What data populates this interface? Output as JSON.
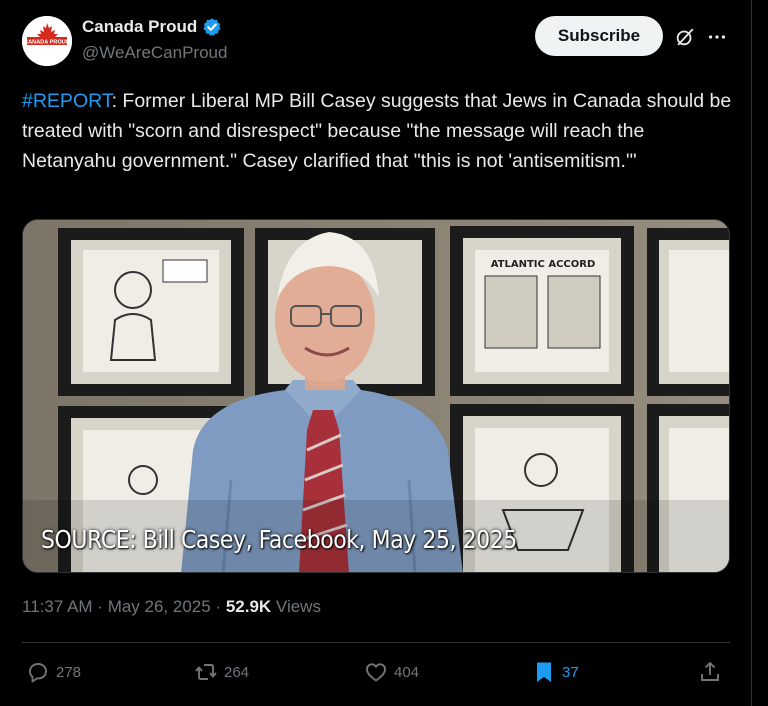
{
  "author": {
    "display_name": "Canada Proud",
    "handle": "@WeAreCanProud",
    "avatar_text": "CANADA PROUD",
    "verified": true
  },
  "subscribe_label": "Subscribe",
  "tweet": {
    "hashtag": "#REPORT",
    "body": ": Former Liberal MP Bill Casey suggests that Jews in Canada should be treated with \"scorn and disrespect\" because \"the message will reach the Netanyahu government.\" Casey clarified that \"this is not 'antisemitism.'\""
  },
  "media": {
    "caption": "SOURCE: Bill Casey, Facebook, May 25, 2025",
    "frame_text": "ATLANTIC ACCORD"
  },
  "meta": {
    "time": "11:37 AM",
    "separator1": " · ",
    "date": "May 26, 2025",
    "separator2": " · ",
    "views_count": "52.9K",
    "views_label": " Views"
  },
  "actions": {
    "replies": "278",
    "reposts": "264",
    "likes": "404",
    "bookmarks": "37"
  },
  "colors": {
    "accent": "#1d9bf0",
    "background": "#000000",
    "text": "#e7e9ea",
    "muted": "#71767b"
  },
  "icons": [
    "verified-badge-icon",
    "grok-icon",
    "more-icon",
    "reply-icon",
    "repost-icon",
    "like-icon",
    "bookmark-icon",
    "share-icon"
  ]
}
